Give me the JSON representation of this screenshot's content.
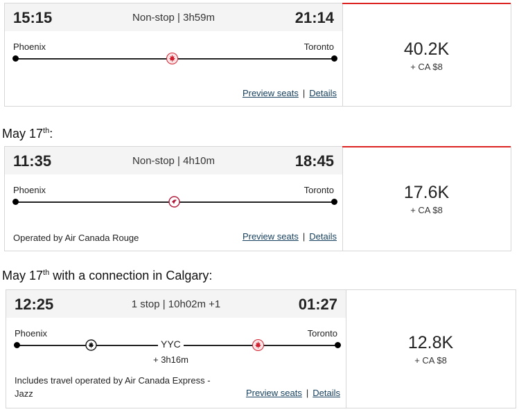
{
  "flights": [
    {
      "dep_time": "15:15",
      "duration": "Non-stop | 3h59m",
      "arr_time": "21:14",
      "origin": "Phoenix",
      "destination": "Toronto",
      "preview_label": "Preview seats",
      "details_label": "Details",
      "price_points": "40.2K",
      "price_cash": "+ CA $8",
      "airline_icon": "maple-leaf-icon",
      "accent_color": "#d22030"
    },
    {
      "label_prefix": "May 17",
      "label_sup": "th",
      "label_suffix": ":",
      "dep_time": "11:35",
      "duration": "Non-stop | 4h10m",
      "arr_time": "18:45",
      "origin": "Phoenix",
      "destination": "Toronto",
      "operator": "Operated by Air Canada Rouge",
      "preview_label": "Preview seats",
      "details_label": "Details",
      "price_points": "17.6K",
      "price_cash": "+ CA $8",
      "airline_icon": "rouge-icon",
      "accent_color": "#b0183a"
    },
    {
      "label_prefix": "May 17",
      "label_sup": "th",
      "label_suffix": " with a connection in Calgary:",
      "dep_time": "12:25",
      "duration": "1 stop | 10h02m +1",
      "arr_time": "01:27",
      "origin": "Phoenix",
      "destination": "Toronto",
      "stop_code": "YYC",
      "layover": "+ 3h16m",
      "operator_line1": "Includes travel operated by Air Canada Express -",
      "operator_line2": "Jazz",
      "preview_label": "Preview seats",
      "details_label": "Details",
      "price_points": "12.8K",
      "price_cash": "+ CA $8",
      "airline_icon_1": "express-icon",
      "airline_icon_2": "maple-leaf-icon"
    }
  ]
}
